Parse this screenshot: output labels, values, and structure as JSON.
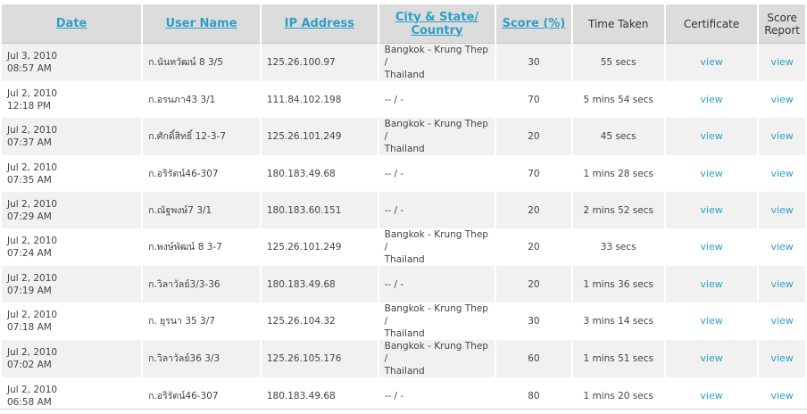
{
  "headers": {
    "date": "Date",
    "user_name": "User Name",
    "ip_address": "IP Address",
    "city_line1": "City & State/",
    "city_line2": "Country",
    "score": "Score (%)",
    "time_taken": "Time Taken",
    "certificate": "Certificate",
    "score_report_line1": "Score",
    "score_report_line2": "Report"
  },
  "rows": [
    {
      "date": "Jul 3, 2010",
      "time": "08:57 AM",
      "user": "ก.นันทวัฒน์ 8 3/5",
      "ip": "125.26.100.97",
      "city1": "Bangkok - Krung Thep /",
      "city2": "Thailand",
      "score": "30",
      "taken": "55 secs",
      "cert": "view",
      "report": "view"
    },
    {
      "date": "Jul 2, 2010",
      "time": "12:18 PM",
      "user": "ก.อรนภา43 3/1",
      "ip": "111.84.102.198",
      "city1": "-- / -",
      "city2": "",
      "score": "70",
      "taken": "5 mins 54 secs",
      "cert": "view",
      "report": "view"
    },
    {
      "date": "Jul 2, 2010",
      "time": "07:37 AM",
      "user": "ก.ศักดิ์สิทธิ์ 12-3-7",
      "ip": "125.26.101.249",
      "city1": "Bangkok - Krung Thep /",
      "city2": "Thailand",
      "score": "20",
      "taken": "45 secs",
      "cert": "view",
      "report": "view"
    },
    {
      "date": "Jul 2, 2010",
      "time": "07:35 AM",
      "user": "ก.อริรัตน์46-307",
      "ip": "180.183.49.68",
      "city1": "-- / -",
      "city2": "",
      "score": "70",
      "taken": "1 mins 28 secs",
      "cert": "view",
      "report": "view"
    },
    {
      "date": "Jul 2, 2010",
      "time": "07:29 AM",
      "user": "ก.ณัฐพงษ์7 3/1",
      "ip": "180.183.60.151",
      "city1": "-- / -",
      "city2": "",
      "score": "20",
      "taken": "2 mins 52 secs",
      "cert": "view",
      "report": "view"
    },
    {
      "date": "Jul 2, 2010",
      "time": "07:24 AM",
      "user": "ก.พงษ์พัฒน์ 8 3-7",
      "ip": "125.26.101.249",
      "city1": "Bangkok - Krung Thep /",
      "city2": "Thailand",
      "score": "20",
      "taken": "33 secs",
      "cert": "view",
      "report": "view"
    },
    {
      "date": "Jul 2, 2010",
      "time": "07:19 AM",
      "user": "ก.วิลาวัลย์3/3-36",
      "ip": "180.183.49.68",
      "city1": "-- / -",
      "city2": "",
      "score": "20",
      "taken": "1 mins 36 secs",
      "cert": "view",
      "report": "view"
    },
    {
      "date": "Jul 2, 2010",
      "time": "07:18 AM",
      "user": "ก. ยุรนา 35 3/7",
      "ip": "125.26.104.32",
      "city1": "Bangkok - Krung Thep /",
      "city2": "Thailand",
      "score": "30",
      "taken": "3 mins 14 secs",
      "cert": "view",
      "report": "view"
    },
    {
      "date": "Jul 2, 2010",
      "time": "07:02 AM",
      "user": "ก.วิลาวัลย์36 3/3",
      "ip": "125.26.105.176",
      "city1": "Bangkok - Krung Thep /",
      "city2": "Thailand",
      "score": "60",
      "taken": "1 mins 51 secs",
      "cert": "view",
      "report": "view"
    },
    {
      "date": "Jul 2, 2010",
      "time": "06:58 AM",
      "user": "ก.อริรัตน์46-307",
      "ip": "180.183.49.68",
      "city1": "-- / -",
      "city2": "",
      "score": "80",
      "taken": "1 mins 20 secs",
      "cert": "view",
      "report": "view"
    }
  ],
  "colors": {
    "link": "#2e9fc8",
    "header_bg": "#dcdcdc",
    "row_odd": "#f1f1f1",
    "row_even": "#ffffff"
  }
}
